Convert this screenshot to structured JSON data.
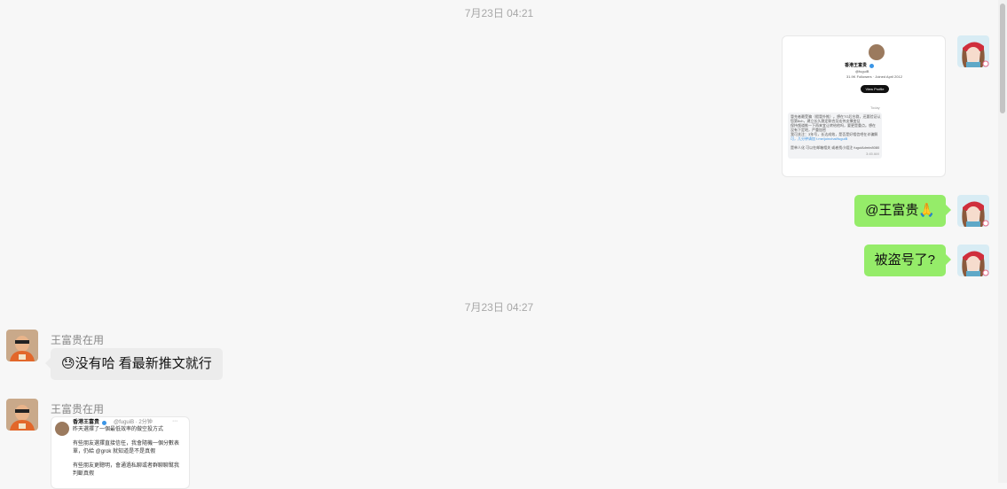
{
  "timestamps": [
    "7月23日 04:21",
    "7月23日 04:27"
  ],
  "messages": {
    "mention": "@王富贵🙏",
    "stolen": "被盗号了?",
    "reply_emoji": "😓",
    "reply_text": "没有哈 看最新推文就行"
  },
  "sender": {
    "name": "王富贵在用"
  },
  "profile_shot": {
    "name": "香港王富贵",
    "handle": "@fuguiB",
    "stats": "31.9K Followers · Joined April 2012",
    "button": "View Profile",
    "day": "Today",
    "lines": [
      "冒充者最受骗（假冒外推）。想在TG后台群，还要验证认",
      "您第8ch，建立长久稳定联合及宏伟支撑变征",
      "保持频道推一下再来宜让转给他吗，要更是重点。想在",
      "没有下定地，严重加密",
      "我可关注：3年号，长达成效，是否是好相信吧在诈骗解",
      "可，几分钟请加 t.me/joinchat/fuguiB",
      "",
      "是单人化 可以在邮箱相关 或者找小组注 fuguiAdmin8080"
    ],
    "time": "3:45 AM"
  },
  "tweet_shot": {
    "name": "香港王富贵",
    "handle": "@fuguiB · 2分钟",
    "lines": [
      "昨天選擇了一個最低效率的做空投方式",
      "",
      "有些朋友選擇直接信任，我會隨機一個分數表",
      "單，仍給 @grok 就知道是不是真假",
      "",
      "有些朋友更聰明，會通過私聊或者群聊聊幫我",
      "判斷真假"
    ]
  },
  "colors": {
    "bubble_self": "#95ec69",
    "bubble_other": "#ececec",
    "background": "#f7f7f7",
    "timestamp": "#a8a8a8"
  },
  "icons": [
    "self-avatar",
    "sender-avatar",
    "verified-badge-icon",
    "more-icon"
  ]
}
